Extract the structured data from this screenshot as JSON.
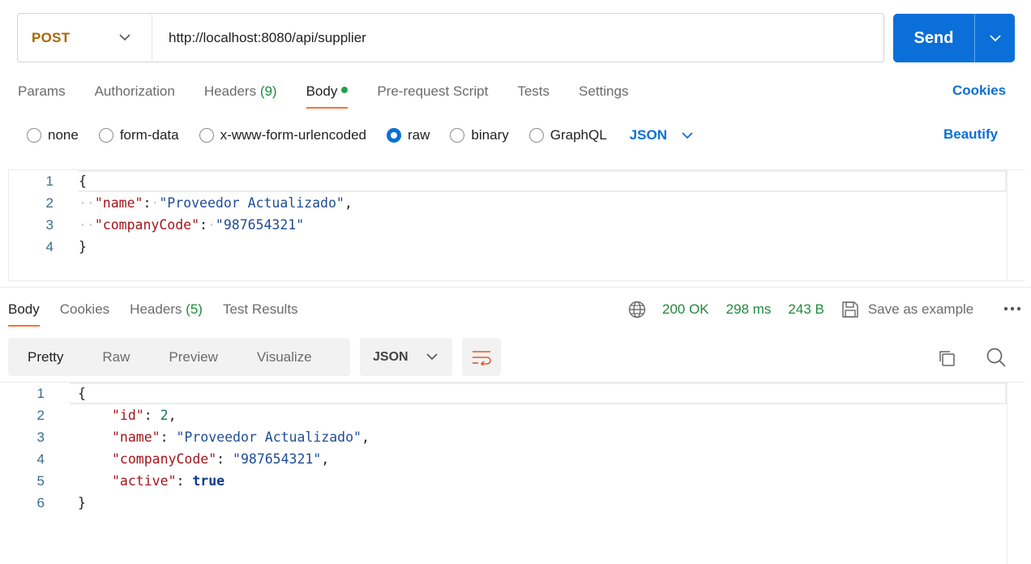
{
  "request": {
    "method": "POST",
    "url": "http://localhost:8080/api/supplier",
    "send_label": "Send"
  },
  "request_tabs": [
    {
      "label": "Params"
    },
    {
      "label": "Authorization"
    },
    {
      "label": "Headers",
      "count": "(9)"
    },
    {
      "label": "Body"
    },
    {
      "label": "Pre-request Script"
    },
    {
      "label": "Tests"
    },
    {
      "label": "Settings"
    }
  ],
  "cookies_label": "Cookies",
  "body_types": [
    "none",
    "form-data",
    "x-www-form-urlencoded",
    "raw",
    "binary",
    "GraphQL"
  ],
  "body_selected": "raw",
  "body_format": "JSON",
  "beautify_label": "Beautify",
  "request_body_lines": [
    {
      "num": "1",
      "open": "{"
    },
    {
      "num": "2",
      "key": "\"name\"",
      "value": "\"Proveedor Actualizado\"",
      "trail": ","
    },
    {
      "num": "3",
      "key": "\"companyCode\"",
      "value": "\"987654321\"",
      "trail": ""
    },
    {
      "num": "4",
      "close": "}"
    }
  ],
  "response_tabs": [
    {
      "label": "Body"
    },
    {
      "label": "Cookies"
    },
    {
      "label": "Headers",
      "count": "(5)"
    },
    {
      "label": "Test Results"
    }
  ],
  "response_meta": {
    "status": "200 OK",
    "time": "298 ms",
    "size": "243 B",
    "save_label": "Save as example"
  },
  "view_modes": [
    "Pretty",
    "Raw",
    "Preview",
    "Visualize"
  ],
  "response_format": "JSON",
  "response_body_lines": [
    {
      "num": "1",
      "text": "{"
    },
    {
      "num": "2",
      "key": "\"id\"",
      "value": "2",
      "trail": ","
    },
    {
      "num": "3",
      "key": "\"name\"",
      "value": "\"Proveedor Actualizado\"",
      "trail": ","
    },
    {
      "num": "4",
      "key": "\"companyCode\"",
      "value": "\"987654321\"",
      "trail": ","
    },
    {
      "num": "5",
      "key": "\"active\"",
      "value": "true",
      "trail": ""
    },
    {
      "num": "6",
      "text": "}"
    }
  ],
  "colors": {
    "accent": "#0b6fd9",
    "method": "#a96700",
    "active_tab_underline": "#ff6c37",
    "success": "#1f8a3c"
  },
  "icons": [
    "chevron-down-icon",
    "globe-icon",
    "save-icon",
    "more-icon",
    "wrap-lines-icon",
    "copy-icon",
    "search-icon"
  ]
}
